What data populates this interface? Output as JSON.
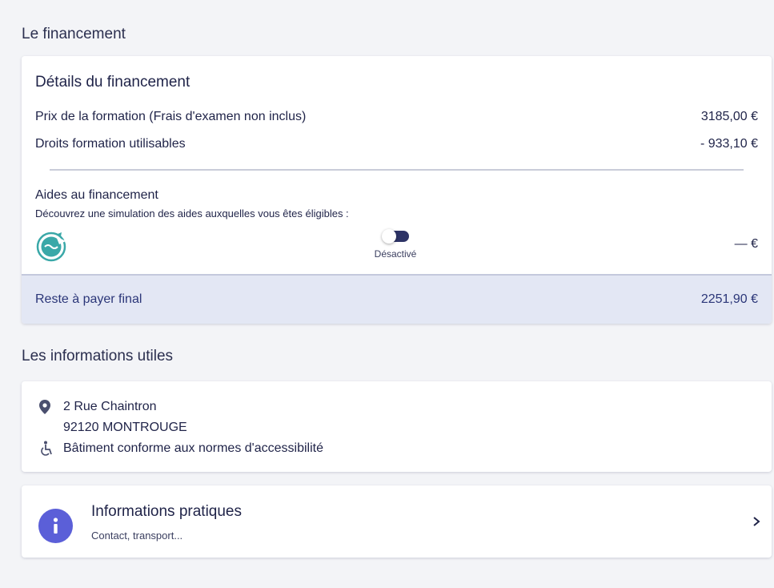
{
  "financement": {
    "section_title": "Le financement",
    "card_title": "Détails du financement",
    "rows": [
      {
        "label": "Prix de la formation (Frais d'examen non inclus)",
        "value": "3185,00 €"
      },
      {
        "label": "Droits formation utilisables",
        "value": "- 933,10 €"
      }
    ],
    "aides": {
      "title": "Aides au financement",
      "subtitle": "Découvrez une simulation des aides auxquelles vous êtes éligibles :",
      "toggle_label": "Désactivé",
      "toggle_on": false,
      "amount": "— €",
      "logo_icon": "eep-logo-icon"
    },
    "reste": {
      "label": "Reste à payer final",
      "value": "2251,90 €"
    }
  },
  "infos": {
    "section_title": "Les informations utiles",
    "address_street": "2 Rue Chaintron",
    "address_city": "92120 MONTROUGE",
    "accessibility": "Bâtiment conforme aux normes d'accessibilité",
    "pratiques_title": "Informations pratiques",
    "pratiques_sub": "Contact, transport..."
  },
  "colors": {
    "accent": "#2d3366",
    "reste_bg": "#e3e7f4",
    "info_icon": "#5b5fd8",
    "logo": "#3aa8a8"
  }
}
